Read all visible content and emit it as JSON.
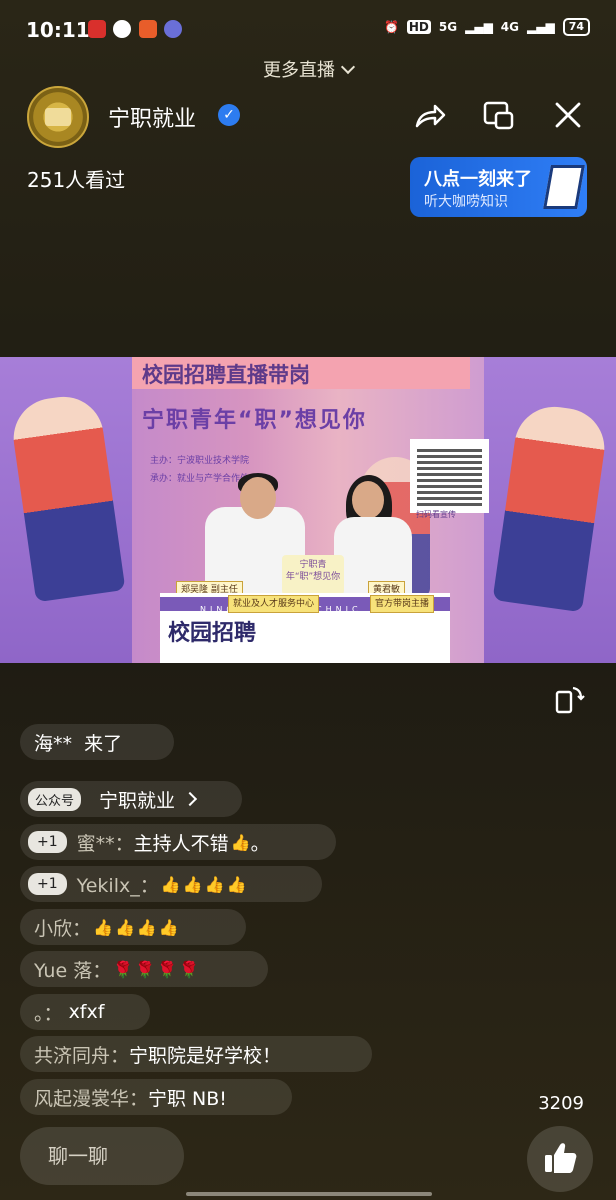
{
  "status_bar": {
    "time": "10:11",
    "hd": "HD",
    "network1": "5G",
    "network2": "4G",
    "battery": "74"
  },
  "top": {
    "more_live": "更多直播"
  },
  "header": {
    "account_name": "宁职就业",
    "viewers": "251人看过"
  },
  "promo": {
    "line1": "八点一刻来了",
    "line2": "听大咖唠知识"
  },
  "video": {
    "banner_title": "校园招聘直播带岗",
    "headline": "宁职青年“职”想见你",
    "host_line": "主办：宁波职业技术学院",
    "organizer_line": "承办：就业与产学合作处",
    "qr_caption": "扫码看宣传",
    "sign_text": "宁职青年“职”想见你",
    "nameplate_left": "郑吴隆 副主任",
    "nameplate_right": "黄君敏",
    "desk_sub_left": "就业及人才服务中心",
    "desk_sub_right": "官方带岗主播",
    "desk_strip": "NINGBO POLYTECHNIC",
    "desk_text": "校园招聘"
  },
  "chat": [
    {
      "type": "join",
      "user": "海**",
      "text": "来了"
    },
    {
      "type": "account",
      "tag": "公众号",
      "text": "宁职就业"
    },
    {
      "type": "plus",
      "badge": "+1",
      "user": "蜜**：",
      "text": "主持人不错",
      "emoji": [
        "thumbs-up"
      ],
      "suffix": "。"
    },
    {
      "type": "plus",
      "badge": "+1",
      "user": "Yekilx_：",
      "text": "",
      "emoji": [
        "thumbs-up",
        "thumbs-up",
        "thumbs-up",
        "thumbs-up"
      ],
      "suffix": ""
    },
    {
      "type": "msg",
      "user": "小欣：",
      "text": "",
      "emoji": [
        "thumbs-up",
        "thumbs-up",
        "thumbs-up",
        "thumbs-up"
      ],
      "suffix": ""
    },
    {
      "type": "msg",
      "user": "Yue 落：",
      "text": "",
      "emoji": [
        "rose",
        "rose",
        "rose",
        "rose"
      ],
      "suffix": ""
    },
    {
      "type": "msg",
      "user": "。：",
      "text": "xfxf"
    },
    {
      "type": "msg",
      "user": "共济同舟：",
      "text": "宁职院是好学校！"
    },
    {
      "type": "msg",
      "user": "风起漫裳华：",
      "text": "宁职 NB!"
    }
  ],
  "footer": {
    "like_count": "3209",
    "input_placeholder": "聊一聊"
  }
}
